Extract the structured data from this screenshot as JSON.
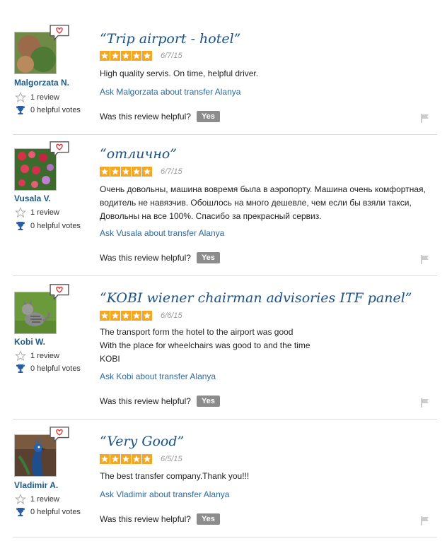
{
  "helpful_prompt": "Was this review helpful?",
  "yes_label": "Yes",
  "icons": {
    "speech_bubble": "speech-bubble-heart-icon",
    "review_count": "star-outline-icon",
    "helpful_votes": "trophy-icon",
    "flag": "flag-icon",
    "rating": "star-icon"
  },
  "colors": {
    "link": "#2c6aa0",
    "title": "#1a5287",
    "star": "#f5a623",
    "button": "#8c8c8c"
  },
  "reviews": [
    {
      "username": "Malgorzata N.",
      "review_count": "1 review",
      "helpful_votes": "0 helpful votes",
      "title": "“Trip airport - hotel”",
      "rating": 5,
      "date": "6/7/15",
      "body": [
        "High quality servis. On time, helpful driver."
      ],
      "ask_link": "Ask Malgorzata about transfer Alanya"
    },
    {
      "username": "Vusala V.",
      "review_count": "1 review",
      "helpful_votes": "0 helpful votes",
      "title": "“отлично”",
      "rating": 5,
      "date": "6/7/15",
      "body": [
        "Очень довольны, машина вовремя была в аэропорту. Машина очень комфортная, водитель не навязчив. Обошлось на много дешевле, чем если бы взяли такси, Довольны на все 100%. Спасибо за прекрасный сервиз."
      ],
      "ask_link": "Ask Vusala about transfer Alanya"
    },
    {
      "username": "Kobi W.",
      "review_count": "1 review",
      "helpful_votes": "0 helpful votes",
      "title": "“KOBI wiener chairman advisories ITF panel”",
      "rating": 5,
      "date": "6/6/15",
      "body": [
        "The transport form the hotel to the airport was good",
        "With the place for wheelchairs was good to and the time",
        "KOBI"
      ],
      "ask_link": "Ask Kobi about transfer Alanya"
    },
    {
      "username": "Vladimir A.",
      "review_count": "1 review",
      "helpful_votes": "0 helpful votes",
      "title": "“Very Good”",
      "rating": 5,
      "date": "6/5/15",
      "body": [
        "The best transfer company.Thank you!!!"
      ],
      "ask_link": "Ask Vladimir about transfer Alanya"
    }
  ]
}
